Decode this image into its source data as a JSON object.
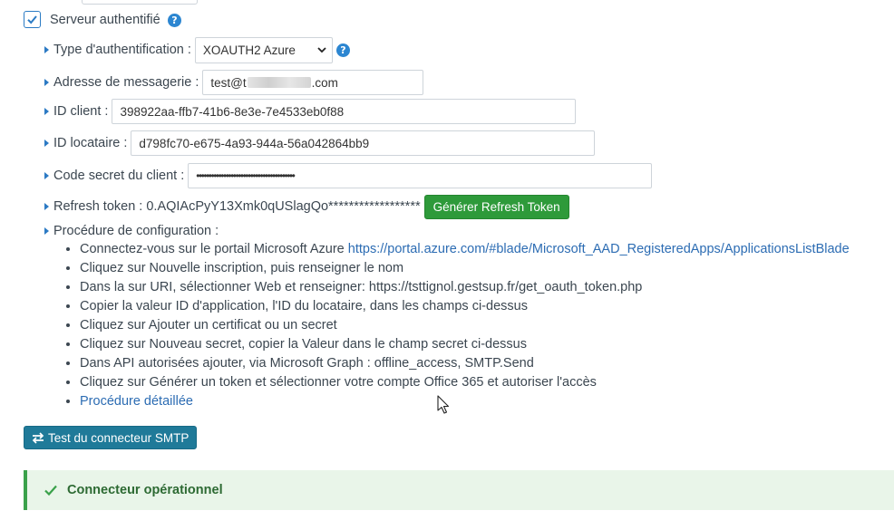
{
  "auth": {
    "checkbox_label": "Serveur authentifié",
    "checked": true
  },
  "fields": {
    "auth_type": {
      "label": "Type d'authentification :",
      "value": "XOAUTH2 Azure"
    },
    "email": {
      "label": "Adresse de messagerie :",
      "value_start": "test@t",
      "value_end": ".com"
    },
    "client_id": {
      "label": "ID client :",
      "value": "398922aa-ffb7-41b6-8e3e-7e4533eb0f88"
    },
    "tenant_id": {
      "label": "ID locataire :",
      "value": "d798fc70-e675-4a93-944a-56a042864bb9"
    },
    "client_secret": {
      "label": "Code secret du client :",
      "value": "••••••••••••••••••••••••••••••••••••••••"
    },
    "refresh_token": {
      "label": "Refresh token : 0.AQIAcPyY13Xmk0qUSlagQo******************",
      "button": "Générer Refresh Token"
    }
  },
  "procedure": {
    "title": "Procédure de configuration :",
    "step1_text": "Connectez-vous sur le portail Microsoft Azure ",
    "step1_link": "https://portal.azure.com/#blade/Microsoft_AAD_RegisteredApps/ApplicationsListBlade",
    "steps": [
      "Cliquez sur Nouvelle inscription, puis renseigner le nom",
      "Dans la sur URI, sélectionner Web et renseigner: https://tsttignol.gestsup.fr/get_oauth_token.php",
      "Copier la valeur ID d'application, l'ID du locataire, dans les champs ci-dessus",
      "Cliquez sur Ajouter un certificat ou un secret",
      "Cliquez sur Nouveau secret, copier la Valeur dans le champ secret ci-dessus",
      "Dans API autorisées ajouter, via Microsoft Graph : offline_access, SMTP.Send",
      "Cliquez sur Générer un token et sélectionner votre compte Office 365 et autoriser l'accès"
    ],
    "detail_link": "Procédure détaillée"
  },
  "test_button": "Test du connecteur SMTP",
  "status": "Connecteur opérationnel",
  "colors": {
    "accent": "#2c7ac4",
    "success": "#2e9a3a",
    "teal_button": "#1f7a99",
    "alert_bg": "#e9f5e9"
  },
  "icons": [
    "checkmark-icon",
    "help-icon",
    "caret-right-icon",
    "chevron-down-icon",
    "swap-arrows-icon",
    "check-icon",
    "mouse-cursor-icon"
  ]
}
